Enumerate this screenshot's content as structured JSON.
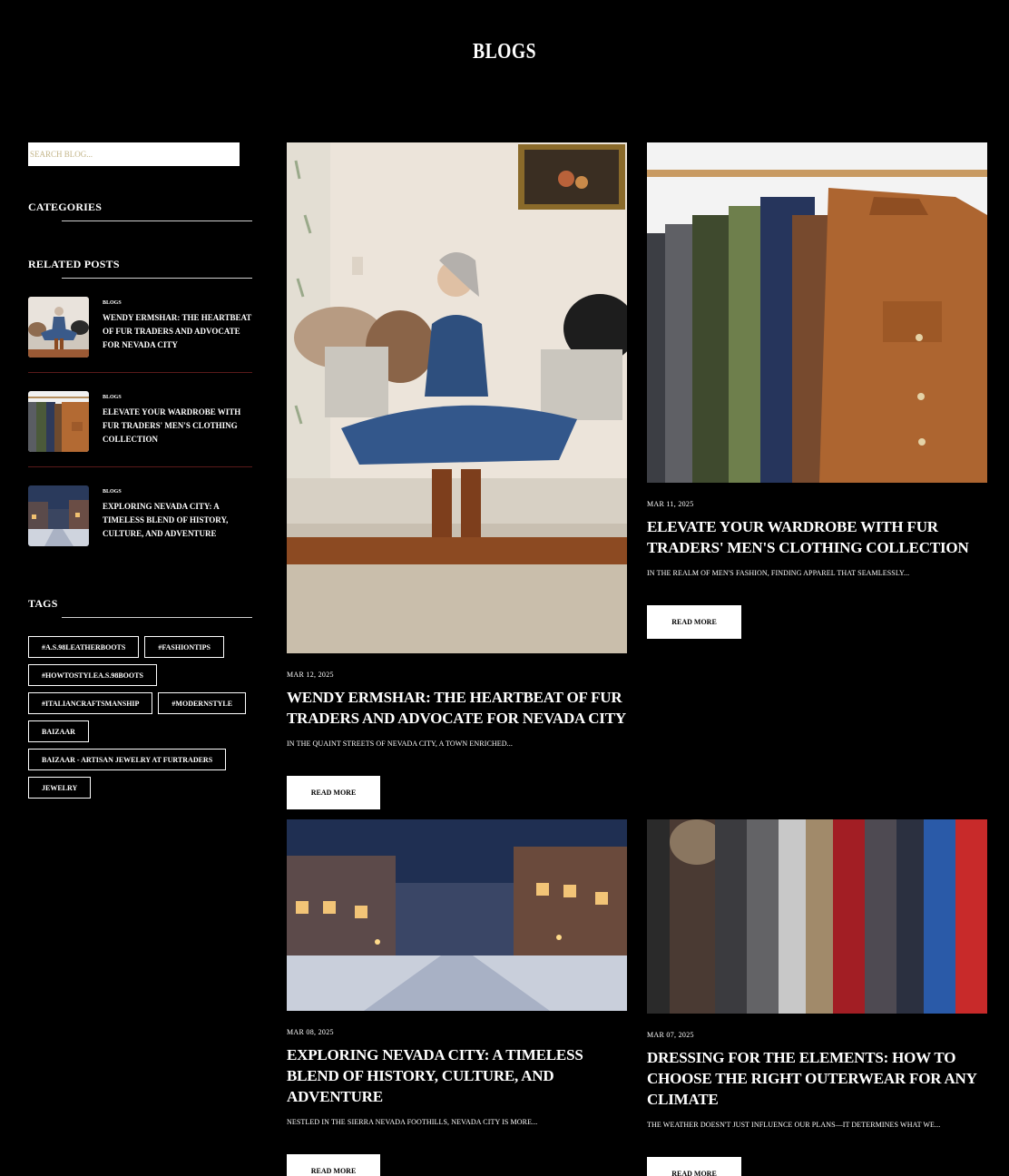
{
  "page": {
    "title": "BLOGS"
  },
  "sidebar": {
    "search_placeholder": "SEARCH BLOG...",
    "categories_heading": "CATEGORIES",
    "related_heading": "RELATED POSTS",
    "related": [
      {
        "category": "BLOGS",
        "title": "WENDY ERMSHAR: THE HEARTBEAT OF FUR TRADERS AND ADVOCATE FOR NEVADA CITY"
      },
      {
        "category": "BLOGS",
        "title": "ELEVATE YOUR WARDROBE WITH FUR TRADERS' MEN'S CLOTHING COLLECTION"
      },
      {
        "category": "BLOGS",
        "title": "EXPLORING NEVADA CITY: A TIMELESS BLEND OF HISTORY, CULTURE, AND ADVENTURE"
      }
    ],
    "tags_heading": "TAGS",
    "tags": [
      "#A.S.98LEATHERBOOTS",
      "#FASHIONTIPS",
      "#HOWTOSTYLEA.S.98BOOTS",
      "#ITALIANCRAFTSMANSHIP",
      "#MODERNSTYLE",
      "BAIZAAR",
      "BAIZAAR - ARTISAN JEWELRY AT FURTRADERS",
      "JEWELRY"
    ]
  },
  "posts": [
    {
      "date": "MAR 12, 2025",
      "title": "WENDY ERMSHAR: THE HEARTBEAT OF FUR TRADERS AND ADVOCATE FOR NEVADA CITY",
      "excerpt": "IN THE QUAINT STREETS OF NEVADA CITY, A TOWN ENRICHED...",
      "button": "READ MORE"
    },
    {
      "date": "MAR 11, 2025",
      "title": "ELEVATE YOUR WARDROBE WITH FUR TRADERS' MEN'S CLOTHING COLLECTION",
      "excerpt": "IN THE REALM OF MEN'S FASHION, FINDING APPAREL THAT SEAMLESSLY...",
      "button": "READ MORE"
    },
    {
      "date": "MAR 08, 2025",
      "title": "EXPLORING NEVADA CITY: A TIMELESS BLEND OF HISTORY, CULTURE, AND ADVENTURE",
      "excerpt": "NESTLED IN THE SIERRA NEVADA FOOTHILLS, NEVADA CITY IS MORE...",
      "button": "READ MORE"
    },
    {
      "date": "MAR 07, 2025",
      "title": "DRESSING FOR THE ELEMENTS: HOW TO CHOOSE THE RIGHT OUTERWEAR FOR ANY CLIMATE",
      "excerpt": "THE WEATHER DOESN'T JUST INFLUENCE OUR PLANS—IT DETERMINES WHAT WE...",
      "button": "READ MORE"
    }
  ]
}
